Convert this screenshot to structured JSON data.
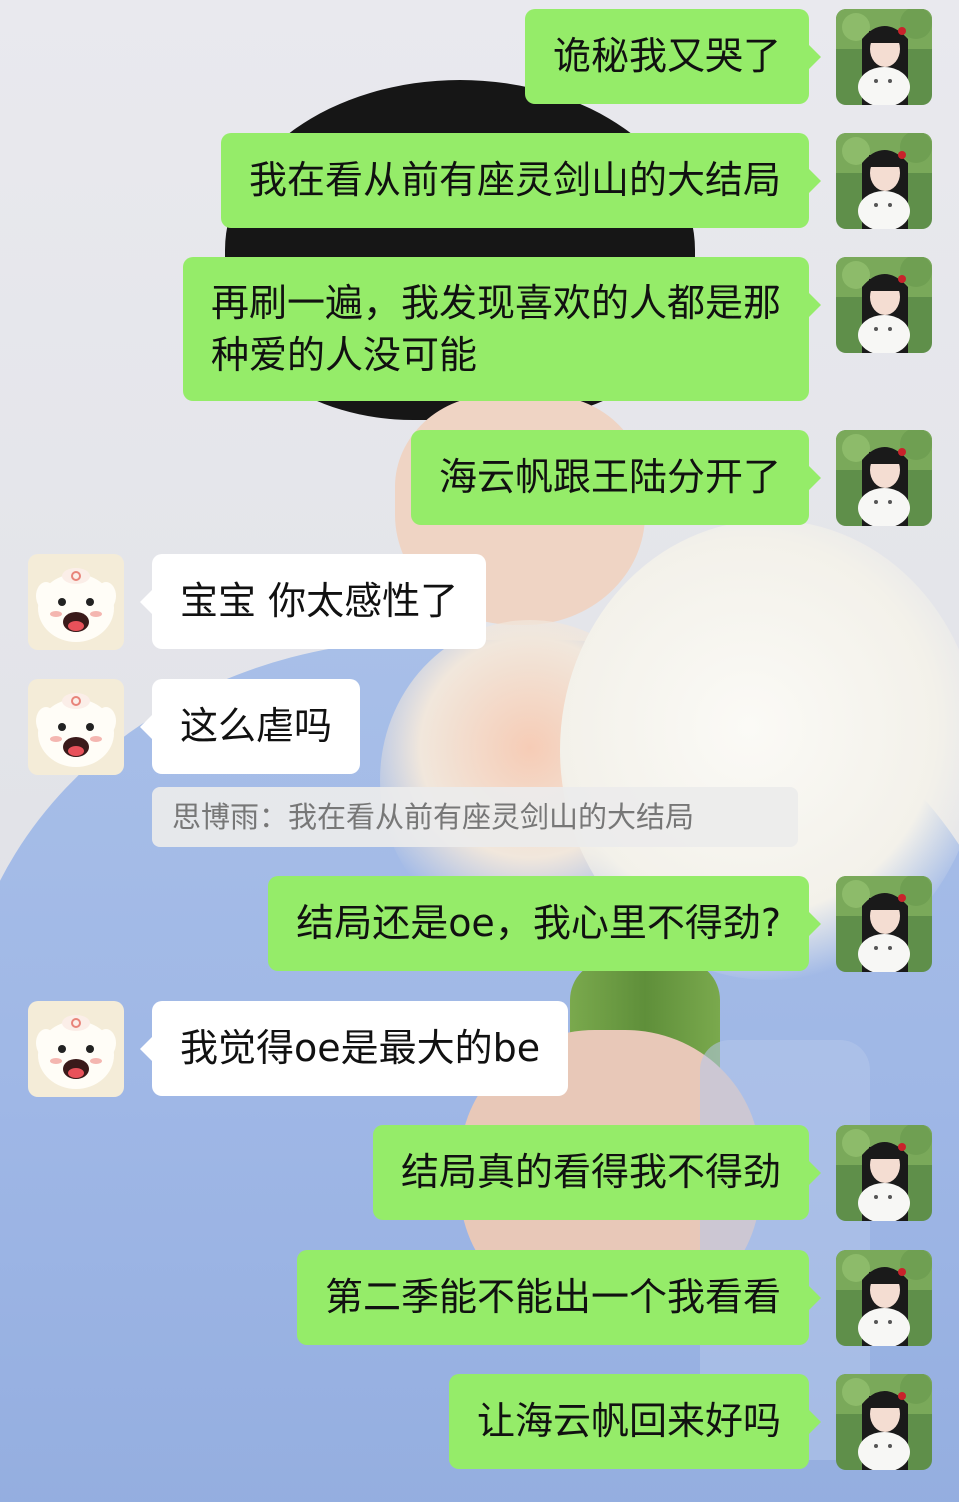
{
  "colors": {
    "my_bubble": "#95ec69",
    "other_bubble": "#ffffff",
    "quote_text": "#777777"
  },
  "avatars": {
    "me": "girl-with-white-cat-avatar",
    "other": "cartoon-dog-avatar"
  },
  "messages": [
    {
      "sender": "me",
      "text": "诡秘我又哭了"
    },
    {
      "sender": "me",
      "text": "我在看从前有座灵剑山的大结局"
    },
    {
      "sender": "me",
      "lines": [
        "再刷一遍，我发现喜欢的人都是那",
        "种爱的人没可能"
      ]
    },
    {
      "sender": "me",
      "text": "海云帆跟王陆分开了"
    },
    {
      "sender": "other",
      "text": "宝宝 你太感性了"
    },
    {
      "sender": "other",
      "text": "这么虐吗",
      "quote": "思博雨：我在看从前有座灵剑山的大结局"
    },
    {
      "sender": "me",
      "text": "结局还是oe，我心里不得劲?"
    },
    {
      "sender": "other",
      "text": "我觉得oe是最大的be"
    },
    {
      "sender": "me",
      "text": "结局真的看得我不得劲"
    },
    {
      "sender": "me",
      "text": "第二季能不能出一个我看看"
    },
    {
      "sender": "me",
      "text": "让海云帆回来好吗"
    }
  ]
}
